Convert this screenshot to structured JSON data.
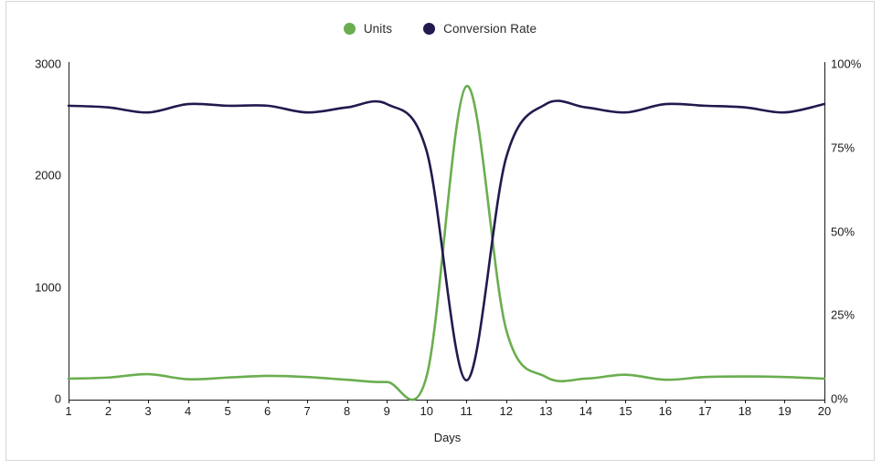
{
  "legend": {
    "position": "top-center",
    "items": [
      {
        "label": "Units",
        "color": "#6aae4f",
        "icon": "circle-marker"
      },
      {
        "label": "Conversion Rate",
        "color": "#211a4e",
        "icon": "circle-marker"
      }
    ]
  },
  "chart_data": {
    "type": "line",
    "title": "",
    "subtitle": "",
    "xlabel": "Days",
    "ylabel": "",
    "grid": false,
    "legend_position": "top-center",
    "x": [
      1,
      2,
      3,
      4,
      5,
      6,
      7,
      8,
      9,
      10,
      11,
      12,
      13,
      14,
      15,
      16,
      17,
      18,
      19,
      20
    ],
    "xtick_labels": [
      "1",
      "2",
      "3",
      "4",
      "5",
      "6",
      "7",
      "8",
      "9",
      "10",
      "11",
      "12",
      "13",
      "14",
      "15",
      "16",
      "17",
      "18",
      "19",
      "20"
    ],
    "axes": {
      "left": {
        "label": "",
        "ylim": [
          0,
          3000
        ],
        "ticks": [
          0,
          1000,
          2000,
          3000
        ],
        "tick_labels": [
          "0",
          "1000",
          "2000",
          "3000"
        ]
      },
      "right": {
        "label": "",
        "ylim": [
          0,
          100
        ],
        "ticks": [
          0,
          25,
          50,
          75,
          100
        ],
        "tick_labels": [
          "0%",
          "25%",
          "50%",
          "75%",
          "100%"
        ]
      }
    },
    "series": [
      {
        "name": "Units",
        "color": "#6aae4f",
        "axis": "left",
        "unit": "units",
        "values": [
          180,
          190,
          220,
          175,
          190,
          205,
          195,
          170,
          150,
          200,
          2800,
          620,
          195,
          180,
          215,
          170,
          195,
          200,
          195,
          180
        ]
      },
      {
        "name": "Conversion Rate",
        "color": "#211a4e",
        "axis": "right",
        "unit": "%",
        "values": [
          87.5,
          87,
          85.5,
          88,
          87.5,
          87.5,
          85.5,
          87,
          88,
          74,
          5.5,
          72,
          88,
          87,
          85.5,
          88,
          87.5,
          87,
          85.5,
          88
        ]
      }
    ]
  },
  "axis_title": {
    "x": "Days"
  }
}
